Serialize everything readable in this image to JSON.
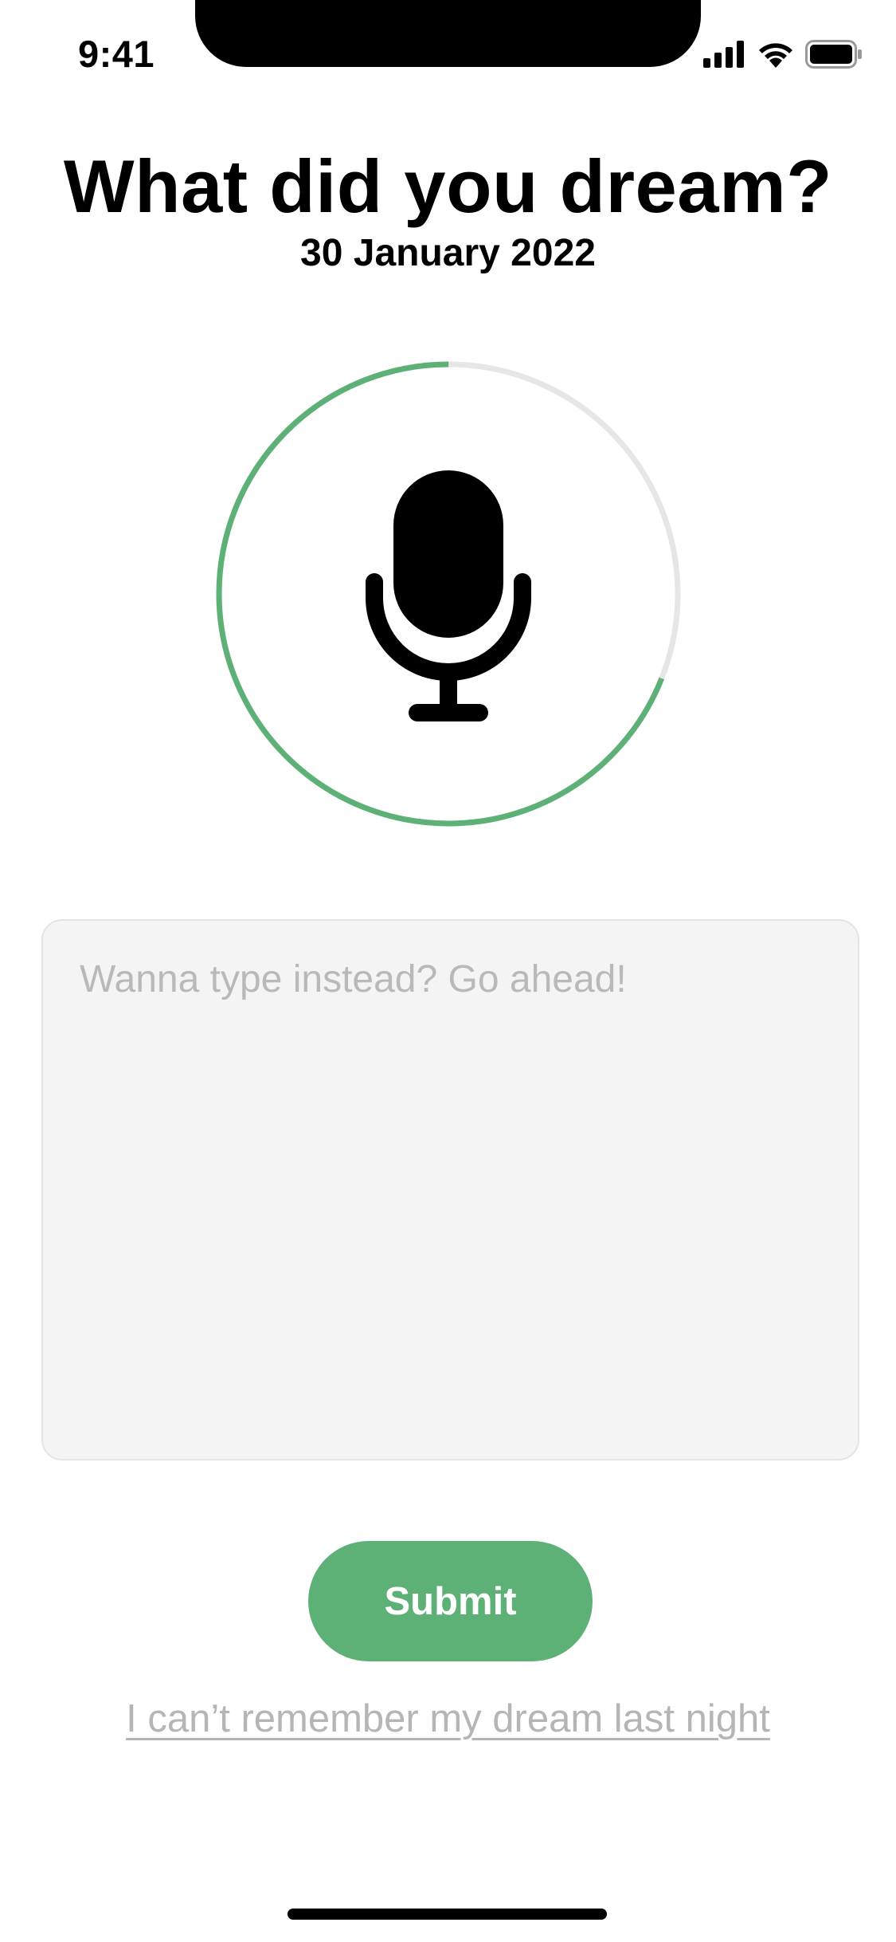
{
  "status_bar": {
    "time": "9:41",
    "icons": [
      "cellular-signal-icon",
      "wifi-icon",
      "battery-icon"
    ]
  },
  "header": {
    "title": "What did you dream?",
    "date": "30 January 2022"
  },
  "recorder": {
    "icon": "microphone-icon",
    "progress": 0.31,
    "progress_color": "#5db176",
    "track_color": "#e6e6e6"
  },
  "dream_input": {
    "placeholder": "Wanna type instead? Go ahead!",
    "value": ""
  },
  "actions": {
    "submit_label": "Submit",
    "forgot_label": "I can’t remember my dream last night"
  },
  "colors": {
    "accent": "#5db176",
    "muted_text": "#b5b5b5",
    "input_bg": "#f4f4f4"
  }
}
